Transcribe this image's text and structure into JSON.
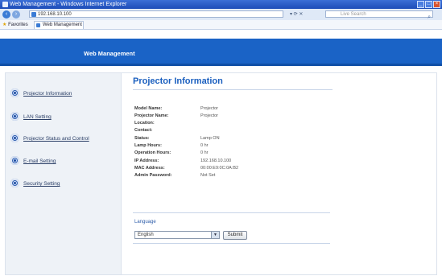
{
  "browser": {
    "window_title": "Web Management - Windows Internet Explorer",
    "address": "192.168.10.100",
    "search_placeholder": "Live Search",
    "favorites_label": "Favorites",
    "tab_title": "Web Management"
  },
  "header": {
    "title": "Web Management"
  },
  "sidebar": {
    "items": [
      {
        "label": "Projector Information"
      },
      {
        "label": "LAN Setting"
      },
      {
        "label": "Projector Status and Control"
      },
      {
        "label": "E-mail Setting"
      },
      {
        "label": "Security Setting"
      }
    ]
  },
  "main": {
    "title": "Projector Information",
    "info": [
      {
        "key": "Model Name:",
        "value": "Projector"
      },
      {
        "key": "Projector Name:",
        "value": "Projector"
      },
      {
        "key": "Location:",
        "value": ""
      },
      {
        "key": "Contact:",
        "value": ""
      },
      {
        "key": "Status:",
        "value": "Lamp ON"
      },
      {
        "key": "Lamp Hours:",
        "value": "0 hr"
      },
      {
        "key": "Operation Hours:",
        "value": "0 hr"
      },
      {
        "key": "IP Address:",
        "value": "192.168.10.100"
      },
      {
        "key": "MAC Address:",
        "value": "00:00:E9:0C:0A:B2"
      },
      {
        "key": "Admin Password:",
        "value": "Not Set"
      }
    ],
    "language": {
      "label": "Language",
      "selected": "English",
      "submit_label": "Submit"
    }
  },
  "colors": {
    "header_blue": "#1a63c6",
    "title_blue": "#1a5fbf",
    "sidebar_bg": "#eef2f7"
  }
}
